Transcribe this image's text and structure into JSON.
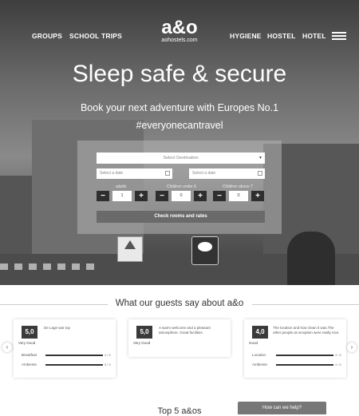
{
  "nav": {
    "left": [
      "GROUPS",
      "SCHOOL TRIPS"
    ],
    "right": [
      "HYGIENE",
      "HOSTEL",
      "HOTEL"
    ],
    "logo": "a&o",
    "logo_sub": "aohostels.com",
    "menu_icon": "hamburger-icon"
  },
  "hero": {
    "title": "Sleep safe & secure",
    "subtitle": "Book your next adventure with Europes No.1",
    "hashtag": "#everyonecantravel"
  },
  "booking": {
    "destination_placeholder": "Select Destination",
    "checkin_placeholder": "Select a date",
    "checkout_placeholder": "Select a date",
    "adults_label": "adults",
    "children_label1": "Children under 6",
    "children_label2": "Children above 7",
    "adults_value": "1",
    "children1_value": "0",
    "children2_value": "0",
    "minus": "−",
    "plus": "+",
    "button": "Check rooms and rates"
  },
  "reviews": {
    "title": "What our guests say about a&o",
    "cards": [
      {
        "score": "5,0",
        "label": "Very Good",
        "text": "De Lage war top",
        "rows": [
          {
            "name": "Breakfast",
            "value": "4 / 5"
          },
          {
            "name": "Ambiente",
            "value": "5 / 5"
          }
        ]
      },
      {
        "score": "5,0",
        "label": "Very Good",
        "text": "A warm welcome and a pleasant atmosphere. Great facilities",
        "rows": []
      },
      {
        "score": "4,0",
        "label": "Good",
        "text": "The location and how clean it was.The other people at reception were really nice.",
        "rows": [
          {
            "name": "Location",
            "value": "4 / 5"
          },
          {
            "name": "Ambiente",
            "value": "4 / 5"
          }
        ]
      }
    ]
  },
  "footer": {
    "top5_title": "Top 5 a&os",
    "help_button": "How can we help?"
  }
}
